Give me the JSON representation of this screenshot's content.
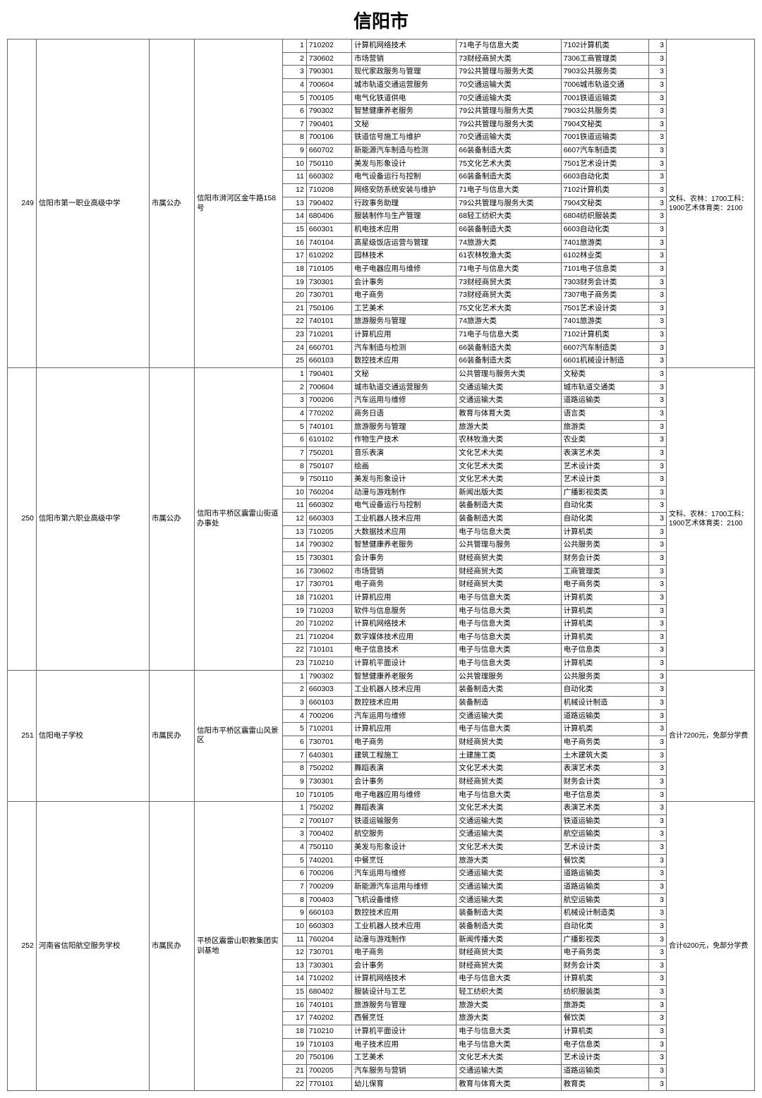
{
  "title": "信阳市",
  "schools": [
    {
      "seq": "249",
      "name": "信阳市第一职业高级中学",
      "type": "市属公办",
      "addr": "信阳市浉河区金牛路158号",
      "note": "文科、农林：1700工科：1900艺术体育类：2100",
      "rows": [
        {
          "n": "1",
          "code": "710202",
          "major": "计算机网络技术",
          "c1": "71电子与信息大类",
          "c2": "7102计算机类",
          "y": "3"
        },
        {
          "n": "2",
          "code": "730602",
          "major": "市场营销",
          "c1": "73财经商贸大类",
          "c2": "7306工商管理类",
          "y": "3"
        },
        {
          "n": "3",
          "code": "790301",
          "major": "现代家政服务与管理",
          "c1": "79公共管理与服务大类",
          "c2": "7903公共服务类",
          "y": "3"
        },
        {
          "n": "4",
          "code": "700604",
          "major": "城市轨道交通运营服务",
          "c1": "70交通运输大类",
          "c2": "7006城市轨道交通",
          "y": "3"
        },
        {
          "n": "5",
          "code": "700105",
          "major": "电气化铁道供电",
          "c1": "70交通运输大类",
          "c2": "7001铁道运输类",
          "y": "3"
        },
        {
          "n": "6",
          "code": "790302",
          "major": "智慧健康养老服务",
          "c1": "79公共管理与服务大类",
          "c2": "7903公共服务类",
          "y": "3"
        },
        {
          "n": "7",
          "code": "790401",
          "major": "文秘",
          "c1": "79公共管理与服务大类",
          "c2": "7904文秘类",
          "y": "3"
        },
        {
          "n": "8",
          "code": "700106",
          "major": "铁道信号施工与维护",
          "c1": "70交通运输大类",
          "c2": "7001铁道运输类",
          "y": "3"
        },
        {
          "n": "9",
          "code": "660702",
          "major": "新能源汽车制造与检测",
          "c1": "66装备制造大类",
          "c2": "6607汽车制造类",
          "y": "3"
        },
        {
          "n": "10",
          "code": "750110",
          "major": "美发与形象设计",
          "c1": "75文化艺术大类",
          "c2": "7501艺术设计类",
          "y": "3"
        },
        {
          "n": "11",
          "code": "660302",
          "major": "电气设备运行与控制",
          "c1": "66装备制造大类",
          "c2": "6603自动化类",
          "y": "3"
        },
        {
          "n": "12",
          "code": "710208",
          "major": "网络安防系统安装与维护",
          "c1": "71电子与信息大类",
          "c2": "7102计算机类",
          "y": "3"
        },
        {
          "n": "13",
          "code": "790402",
          "major": "行政事务助理",
          "c1": "79公共管理与服务大类",
          "c2": "7904文秘类",
          "y": "3"
        },
        {
          "n": "14",
          "code": "680406",
          "major": "服装制作与生产管理",
          "c1": "68轻工纺织大类",
          "c2": "6804纺织服装类",
          "y": "3"
        },
        {
          "n": "15",
          "code": "660301",
          "major": "机电技术应用",
          "c1": "66装备制造大类",
          "c2": "6603自动化类",
          "y": "3"
        },
        {
          "n": "16",
          "code": "740104",
          "major": "高星级饭店运营与管理",
          "c1": "74旅游大类",
          "c2": "7401旅游类",
          "y": "3"
        },
        {
          "n": "17",
          "code": "610202",
          "major": "园林技术",
          "c1": "61农林牧渔大类",
          "c2": "6102林业类",
          "y": "3"
        },
        {
          "n": "18",
          "code": "710105",
          "major": "电子电器应用与维修",
          "c1": "71电子与信息大类",
          "c2": "7101电子信息类",
          "y": "3"
        },
        {
          "n": "19",
          "code": "730301",
          "major": "会计事务",
          "c1": "73财经商贸大类",
          "c2": "7303财务会计类",
          "y": "3"
        },
        {
          "n": "20",
          "code": "730701",
          "major": "电子商务",
          "c1": "73财经商贸大类",
          "c2": "7307电子商务类",
          "y": "3"
        },
        {
          "n": "21",
          "code": "750106",
          "major": "工艺美术",
          "c1": "75文化艺术大类",
          "c2": "7501艺术设计类",
          "y": "3"
        },
        {
          "n": "22",
          "code": "740101",
          "major": "旅游服务与管理",
          "c1": "74旅游大类",
          "c2": "7401旅游类",
          "y": "3"
        },
        {
          "n": "23",
          "code": "710201",
          "major": "计算机应用",
          "c1": "71电子与信息大类",
          "c2": "7102计算机类",
          "y": "3"
        },
        {
          "n": "24",
          "code": "660701",
          "major": "汽车制造与检测",
          "c1": "66装备制造大类",
          "c2": "6607汽车制造类",
          "y": "3"
        },
        {
          "n": "25",
          "code": "660103",
          "major": "数控技术应用",
          "c1": "66装备制造大类",
          "c2": "6601机械设计制造",
          "y": "3"
        }
      ]
    },
    {
      "seq": "250",
      "name": "信阳市第六职业高级中学",
      "type": "市属公办",
      "addr": "信阳市平桥区震雷山街道办事处",
      "note": "文科、农林：1700工科：1900艺术体育类：2100",
      "rows": [
        {
          "n": "1",
          "code": "790401",
          "major": "文秘",
          "c1": "公共管理与服务大类",
          "c2": "文秘类",
          "y": "3"
        },
        {
          "n": "2",
          "code": "700604",
          "major": "城市轨道交通运营服务",
          "c1": "交通运输大类",
          "c2": "城市轨道交通类",
          "y": "3"
        },
        {
          "n": "3",
          "code": "700206",
          "major": "汽车运用与维修",
          "c1": "交通运输大类",
          "c2": "道路运输类",
          "y": "3"
        },
        {
          "n": "4",
          "code": "770202",
          "major": "商务日语",
          "c1": "教育与体育大类",
          "c2": "语言类",
          "y": "3"
        },
        {
          "n": "5",
          "code": "740101",
          "major": "旅游服务与管理",
          "c1": "旅游大类",
          "c2": "旅游类",
          "y": "3"
        },
        {
          "n": "6",
          "code": "610102",
          "major": "作物生产技术",
          "c1": "农林牧渔大类",
          "c2": "农业类",
          "y": "3"
        },
        {
          "n": "7",
          "code": "750201",
          "major": "音乐表演",
          "c1": "文化艺术大类",
          "c2": "表演艺术类",
          "y": "3"
        },
        {
          "n": "8",
          "code": "750107",
          "major": "绘画",
          "c1": "文化艺术大类",
          "c2": "艺术设计类",
          "y": "3"
        },
        {
          "n": "9",
          "code": "750110",
          "major": "美发与形象设计",
          "c1": "文化艺术大类",
          "c2": "艺术设计类",
          "y": "3"
        },
        {
          "n": "10",
          "code": "760204",
          "major": "动漫与游戏制作",
          "c1": "新闻出版大类",
          "c2": "广播影视类类",
          "y": "3"
        },
        {
          "n": "11",
          "code": "660302",
          "major": "电气设备运行与控制",
          "c1": "装备制造大类",
          "c2": "自动化类",
          "y": "3"
        },
        {
          "n": "12",
          "code": "660303",
          "major": "工业机器人技术应用",
          "c1": "装备制造大类",
          "c2": "自动化类",
          "y": "3"
        },
        {
          "n": "13",
          "code": "710205",
          "major": "大数据技术应用",
          "c1": "电子与信息大类",
          "c2": "计算机类",
          "y": "3"
        },
        {
          "n": "14",
          "code": "790302",
          "major": "智慧健康养老服务",
          "c1": "公共管理与服务",
          "c2": "公共服务类",
          "y": "3"
        },
        {
          "n": "15",
          "code": "730301",
          "major": "会计事务",
          "c1": "财经商贸大类",
          "c2": "财务会计类",
          "y": "3"
        },
        {
          "n": "16",
          "code": "730602",
          "major": "市场营销",
          "c1": "财经商贸大类",
          "c2": "工商管理类",
          "y": "3"
        },
        {
          "n": "17",
          "code": "730701",
          "major": "电子商务",
          "c1": "财经商贸大类",
          "c2": "电子商务类",
          "y": "3"
        },
        {
          "n": "18",
          "code": "710201",
          "major": "计算机应用",
          "c1": "电子与信息大类",
          "c2": "计算机类",
          "y": "3"
        },
        {
          "n": "19",
          "code": "710203",
          "major": "软件与信息服务",
          "c1": "电子与信息大类",
          "c2": "计算机类",
          "y": "3"
        },
        {
          "n": "20",
          "code": "710202",
          "major": "计算机网络技术",
          "c1": "电子与信息大类",
          "c2": "计算机类",
          "y": "3"
        },
        {
          "n": "21",
          "code": "710204",
          "major": "数字媒体技术应用",
          "c1": "电子与信息大类",
          "c2": "计算机类",
          "y": "3"
        },
        {
          "n": "22",
          "code": "710101",
          "major": "电子信息技术",
          "c1": "电子与信息大类",
          "c2": "电子信息类",
          "y": "3"
        },
        {
          "n": "23",
          "code": "710210",
          "major": "计算机平面设计",
          "c1": "电子与信息大类",
          "c2": "计算机类",
          "y": "3"
        }
      ]
    },
    {
      "seq": "251",
      "name": "信阳电子学校",
      "type": "市属民办",
      "addr": "信阳市平桥区震雷山风景区",
      "note": "合计7200元，免部分学费",
      "rows": [
        {
          "n": "1",
          "code": "790302",
          "major": "智慧健康养老服务",
          "c1": "公共管理服务",
          "c2": "公共服务类",
          "y": "3"
        },
        {
          "n": "2",
          "code": "660303",
          "major": "工业机器人技术应用",
          "c1": "装备制造大类",
          "c2": "自动化类",
          "y": "3"
        },
        {
          "n": "3",
          "code": "660103",
          "major": "数控技术应用",
          "c1": "装备制造",
          "c2": "机械设计制造",
          "y": "3"
        },
        {
          "n": "4",
          "code": "700206",
          "major": "汽车运用与维修",
          "c1": "交通运输大类",
          "c2": "道路运输类",
          "y": "3"
        },
        {
          "n": "5",
          "code": "710201",
          "major": "计算机应用",
          "c1": "电子与信息大类",
          "c2": "计算机类",
          "y": "3"
        },
        {
          "n": "6",
          "code": "730701",
          "major": "电子商务",
          "c1": "财经商贸大类",
          "c2": "电子商务类",
          "y": "3"
        },
        {
          "n": "7",
          "code": "640301",
          "major": "建筑工程施工",
          "c1": "土建施工类",
          "c2": "土木建筑大类",
          "y": "3"
        },
        {
          "n": "8",
          "code": "750202",
          "major": "舞蹈表演",
          "c1": "文化艺术大类",
          "c2": "表演艺术类",
          "y": "3"
        },
        {
          "n": "9",
          "code": "730301",
          "major": "会计事务",
          "c1": "财经商贸大类",
          "c2": "财务会计类",
          "y": "3"
        },
        {
          "n": "10",
          "code": "710105",
          "major": "电子电器应用与维修",
          "c1": "电子与信息大类",
          "c2": "电子信息类",
          "y": "3"
        }
      ]
    },
    {
      "seq": "252",
      "name": "河南省信阳航空服务学校",
      "type": "市属民办",
      "addr": "平桥区震雷山职教集团实训基地",
      "note": "合计6200元，免部分学费",
      "rows": [
        {
          "n": "1",
          "code": "750202",
          "major": "舞蹈表演",
          "c1": "文化艺术大类",
          "c2": "表演艺术类",
          "y": "3"
        },
        {
          "n": "2",
          "code": "700107",
          "major": "铁道运输服务",
          "c1": "交通运输大类",
          "c2": "铁道运输类",
          "y": "3"
        },
        {
          "n": "3",
          "code": "700402",
          "major": "航空服务",
          "c1": "交通运输大类",
          "c2": "航空运输类",
          "y": "3"
        },
        {
          "n": "4",
          "code": "750110",
          "major": "美发与形象设计",
          "c1": "文化艺术大类",
          "c2": "艺术设计类",
          "y": "3"
        },
        {
          "n": "5",
          "code": "740201",
          "major": "中餐烹饪",
          "c1": "旅游大类",
          "c2": "餐饮类",
          "y": "3"
        },
        {
          "n": "6",
          "code": "700206",
          "major": "汽车运用与维修",
          "c1": "交通运输大类",
          "c2": "道路运输类",
          "y": "3"
        },
        {
          "n": "7",
          "code": "700209",
          "major": "新能源汽车运用与维修",
          "c1": "交通运输大类",
          "c2": "道路运输类",
          "y": "3"
        },
        {
          "n": "8",
          "code": "700403",
          "major": "飞机设备维修",
          "c1": "交通运输大类",
          "c2": "航空运输类",
          "y": "3"
        },
        {
          "n": "9",
          "code": "660103",
          "major": "数控技术应用",
          "c1": "装备制造大类",
          "c2": "机械设计制造类",
          "y": "3"
        },
        {
          "n": "10",
          "code": "660303",
          "major": "工业机器人技术应用",
          "c1": "装备制造大类",
          "c2": "自动化类",
          "y": "3"
        },
        {
          "n": "11",
          "code": "760204",
          "major": "动漫与游戏制作",
          "c1": "新闻传播大类",
          "c2": "广播影视类",
          "y": "3"
        },
        {
          "n": "12",
          "code": "730701",
          "major": "电子商务",
          "c1": "财经商贸大类",
          "c2": "电子商务类",
          "y": "3"
        },
        {
          "n": "13",
          "code": "730301",
          "major": "会计事务",
          "c1": "财经商贸大类",
          "c2": "财务会计类",
          "y": "3"
        },
        {
          "n": "14",
          "code": "710202",
          "major": "计算机网络技术",
          "c1": "电子与信息大类",
          "c2": "计算机类",
          "y": "3"
        },
        {
          "n": "15",
          "code": "680402",
          "major": "服装设计与工艺",
          "c1": "轻工纺织大类",
          "c2": "纺织服装类",
          "y": "3"
        },
        {
          "n": "16",
          "code": "740101",
          "major": "旅游服务与管理",
          "c1": "旅游大类",
          "c2": "旅游类",
          "y": "3"
        },
        {
          "n": "17",
          "code": "740202",
          "major": "西餐烹饪",
          "c1": "旅游大类",
          "c2": "餐饮类",
          "y": "3"
        },
        {
          "n": "18",
          "code": "710210",
          "major": "计算机平面设计",
          "c1": "电子与信息大类",
          "c2": "计算机类",
          "y": "3"
        },
        {
          "n": "19",
          "code": "710103",
          "major": "电子技术应用",
          "c1": "电子与信息大类",
          "c2": "电子信息类",
          "y": "3"
        },
        {
          "n": "20",
          "code": "750106",
          "major": "工艺美术",
          "c1": "文化艺术大类",
          "c2": "艺术设计类",
          "y": "3"
        },
        {
          "n": "21",
          "code": "700205",
          "major": "汽车服务与营销",
          "c1": "交通运输大类",
          "c2": "道路运输类",
          "y": "3"
        },
        {
          "n": "22",
          "code": "770101",
          "major": "幼儿保育",
          "c1": "教育与体育大类",
          "c2": "教育类",
          "y": "3"
        }
      ]
    }
  ]
}
